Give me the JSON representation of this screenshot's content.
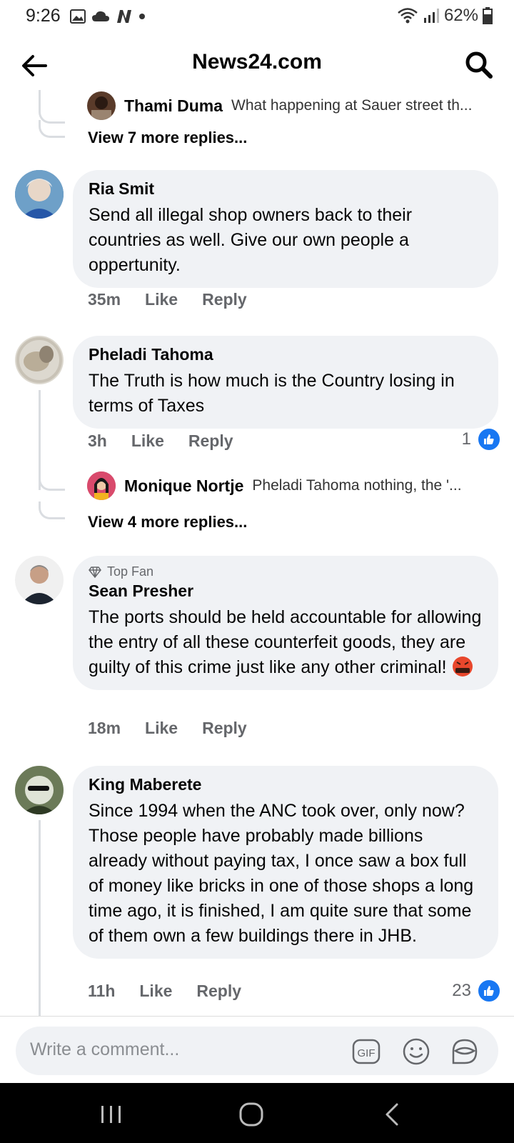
{
  "status_bar": {
    "time": "9:26",
    "battery": "62%"
  },
  "app_bar": {
    "title": "News24.com"
  },
  "comments": [
    {
      "id": "thread0",
      "reply_preview": {
        "name": "Thami Duma",
        "text": "What happening at Sauer street th..."
      },
      "view_more": "View 7 more replies..."
    },
    {
      "name": "Ria Smit",
      "text": "Send all illegal shop owners back to their countries as well. Give our own people a oppertunity.",
      "time": "35m",
      "like": "Like",
      "reply": "Reply"
    },
    {
      "name": "Pheladi Tahoma",
      "text": "The Truth is  how much is the Country  losing in terms  of Taxes",
      "time": "3h",
      "like": "Like",
      "reply": "Reply",
      "likes": "1",
      "reply_preview": {
        "name": "Monique Nortje",
        "text": "Pheladi Tahoma nothing, the '..."
      },
      "view_more": "View 4 more replies..."
    },
    {
      "badge": "Top Fan",
      "name": "Sean Presher",
      "text": "The ports should be held accountable for allowing the entry of all these counterfeit goods, they are guilty of this crime just like any other criminal!",
      "emoji": "angry-face-emoji",
      "time": "18m",
      "like": "Like",
      "reply": "Reply"
    },
    {
      "name": "King Maberete",
      "text": "Since 1994 when the ANC took over, only now? Those people have probably made billions already without paying tax, I once saw a box full of money like bricks in one of those shops a long time ago, it is finished, I am quite sure that some of them own a few buildings there in JHB.",
      "time": "11h",
      "like": "Like",
      "reply": "Reply",
      "likes": "23"
    }
  ],
  "composer": {
    "placeholder": "Write a comment...",
    "gif_label": "GIF"
  },
  "colors": {
    "accent": "#1877f2",
    "bubble": "#f0f2f5",
    "meta": "#65676b"
  }
}
